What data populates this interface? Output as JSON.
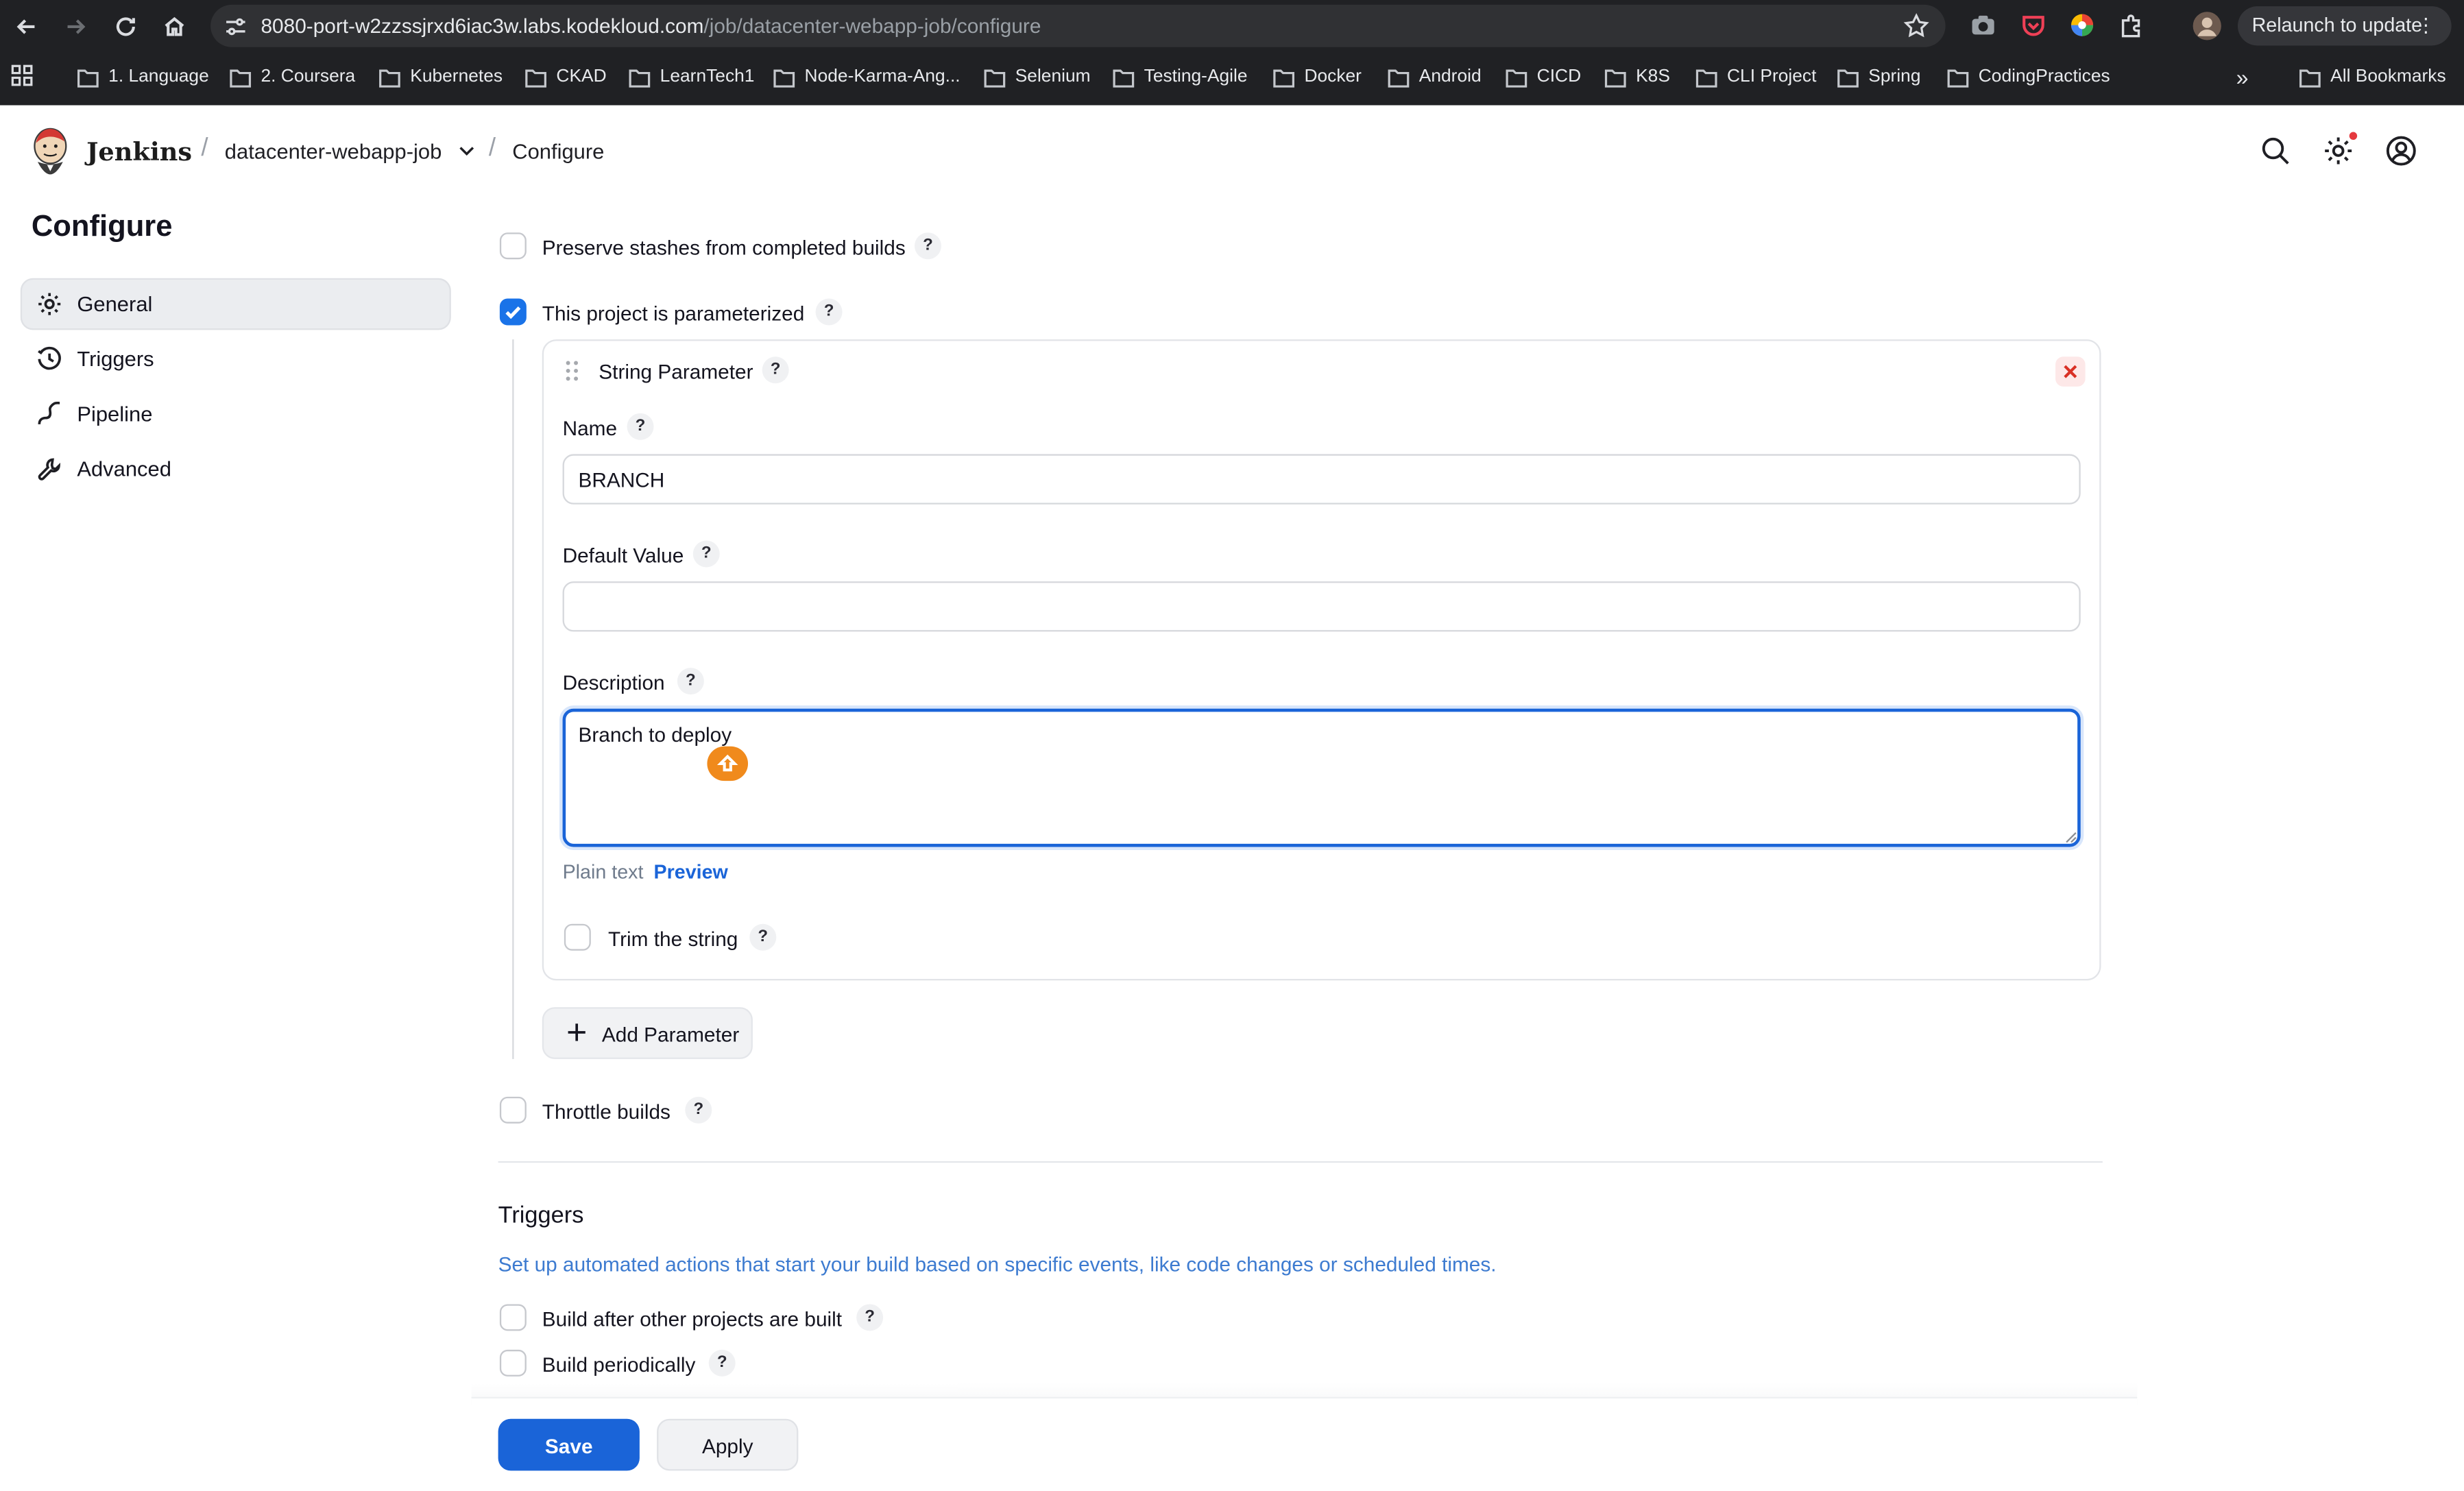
{
  "browser": {
    "url_host": "8080-port-w2zzssjrxd6iac3w.labs.kodekloud.com",
    "url_path": "/job/datacenter-webapp-job/configure",
    "relaunch_label": "Relaunch to update",
    "bookmarks": [
      "1. Language",
      "2. Coursera",
      "Kubernetes",
      "CKAD",
      "LearnTech1",
      "Node-Karma-Ang...",
      "Selenium",
      "Testing-Agile",
      "Docker",
      "Android",
      "CICD",
      "K8S",
      "CLI Project",
      "Spring",
      "CodingPractices"
    ],
    "all_bookmarks_label": "All Bookmarks",
    "overflow_label": "»"
  },
  "header": {
    "brand": "Jenkins",
    "breadcrumbs": [
      "datacenter-webapp-job",
      "Configure"
    ],
    "separator": "/"
  },
  "sidebar": {
    "title": "Configure",
    "items": [
      {
        "label": "General",
        "active": true
      },
      {
        "label": "Triggers",
        "active": false
      },
      {
        "label": "Pipeline",
        "active": false
      },
      {
        "label": "Advanced",
        "active": false
      }
    ]
  },
  "general": {
    "preserve_stashes": {
      "label": "Preserve stashes from completed builds",
      "checked": false
    },
    "parameterized": {
      "label": "This project is parameterized",
      "checked": true
    },
    "help_mark": "?",
    "string_parameter": {
      "title": "String Parameter",
      "name_label": "Name",
      "name_value": "BRANCH",
      "default_label": "Default Value",
      "default_value": "",
      "description_label": "Description",
      "description_value": "Branch to deploy",
      "format_plain": "Plain text",
      "format_preview": "Preview",
      "trim": {
        "label": "Trim the string",
        "checked": false
      }
    },
    "add_parameter_label": "Add Parameter",
    "throttle": {
      "label": "Throttle builds",
      "checked": false
    }
  },
  "triggers": {
    "title": "Triggers",
    "description": "Set up automated actions that start your build based on specific events, like code changes or scheduled times.",
    "build_after": {
      "label": "Build after other projects are built",
      "checked": false
    },
    "build_periodically": {
      "label": "Build periodically",
      "checked": false
    }
  },
  "footer": {
    "save_label": "Save",
    "apply_label": "Apply"
  },
  "colors": {
    "accent": "#1a64d8",
    "checkbox_checked": "#1a73e8",
    "chrome_bg": "#202124",
    "link_blue": "#3d7bd0"
  }
}
